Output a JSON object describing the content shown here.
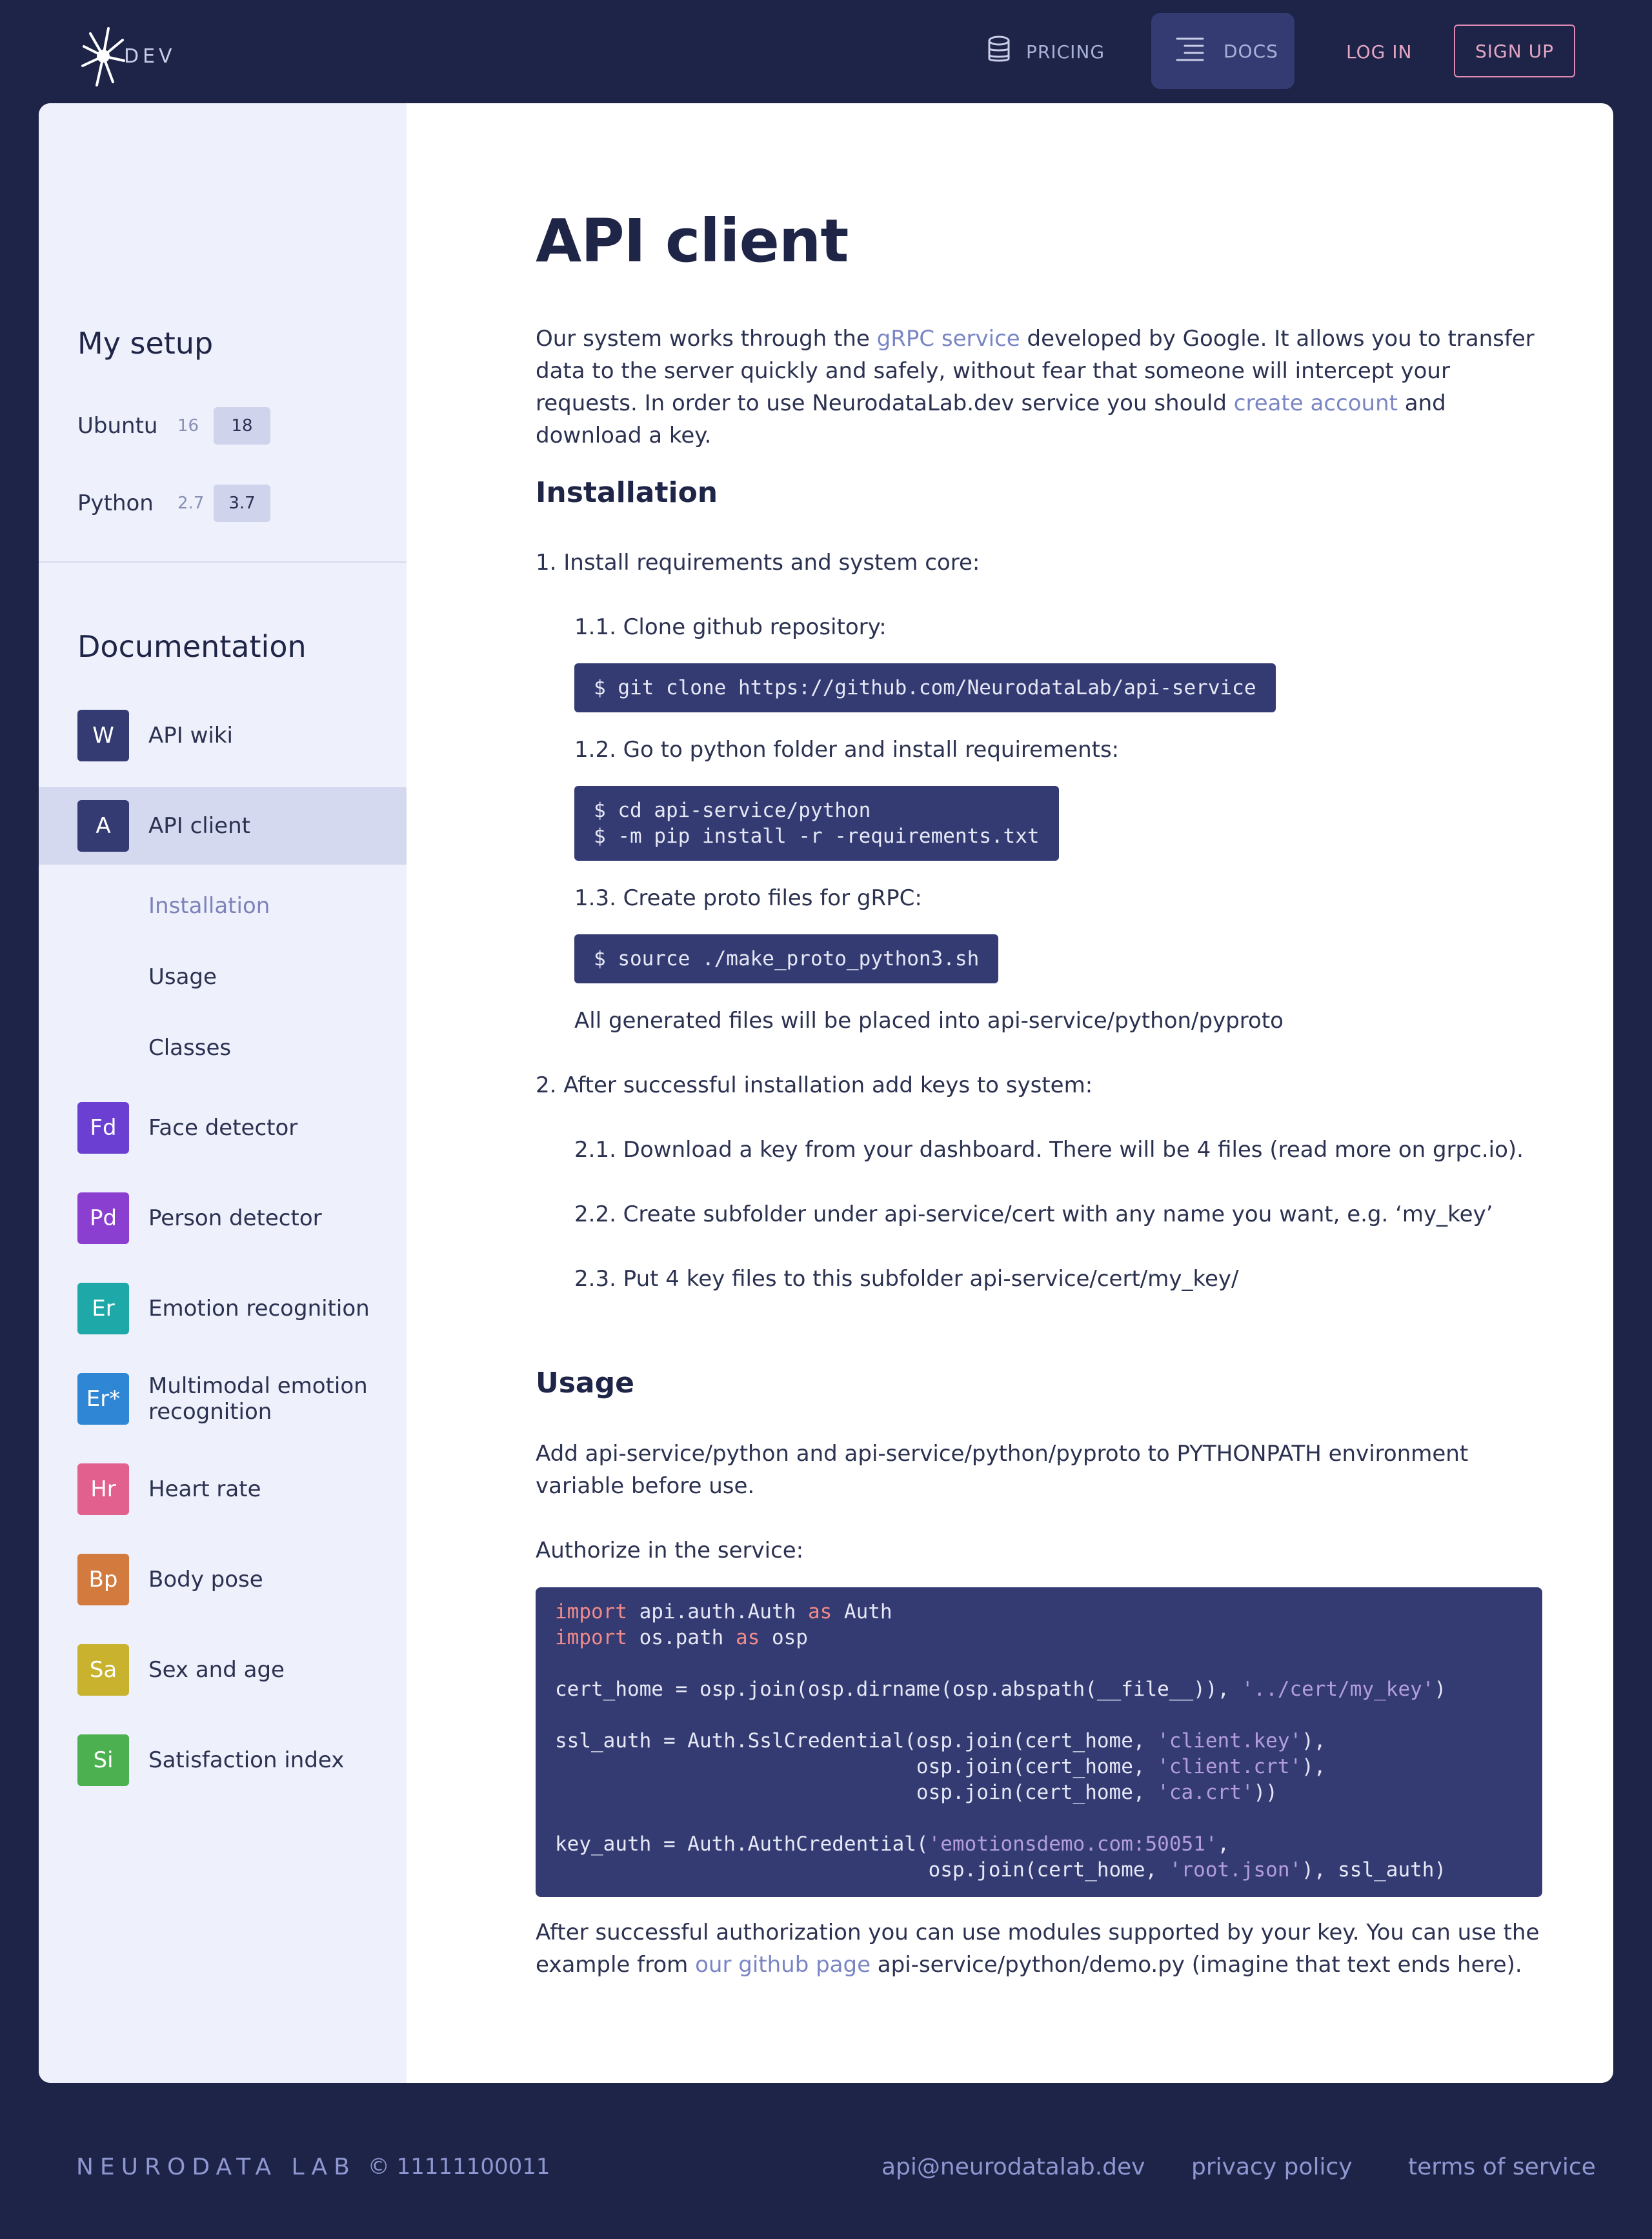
{
  "header": {
    "logo_text": "DEV",
    "nav": {
      "pricing": "PRICING",
      "docs": "DOCS",
      "login": "LOG IN",
      "signup": "SIGN UP"
    }
  },
  "sidebar": {
    "setup_title": "My setup",
    "setup": [
      {
        "label": "Ubuntu",
        "alt": "16",
        "selected": "18"
      },
      {
        "label": "Python",
        "alt": "2.7",
        "selected": "3.7"
      }
    ],
    "docs_title": "Documentation",
    "items": [
      {
        "badge": "W",
        "label": "API wiki",
        "color": "#333b72"
      },
      {
        "badge": "A",
        "label": "API client",
        "color": "#333b72",
        "active": true
      },
      {
        "badge": "Fd",
        "label": "Face detector",
        "color": "#6a3fd1"
      },
      {
        "badge": "Pd",
        "label": "Person detector",
        "color": "#8b3fd1"
      },
      {
        "badge": "Er",
        "label": "Emotion recognition",
        "color": "#1ea8a8"
      },
      {
        "badge": "Er*",
        "label": "Multimodal emotion recognition",
        "color": "#2f86d4"
      },
      {
        "badge": "Hr",
        "label": "Heart rate",
        "color": "#e2608d"
      },
      {
        "badge": "Bp",
        "label": "Body pose",
        "color": "#d37a3e"
      },
      {
        "badge": "Sa",
        "label": "Sex and age",
        "color": "#c9b22d"
      },
      {
        "badge": "Si",
        "label": "Satisfaction index",
        "color": "#4caf50"
      }
    ],
    "subitems": [
      "Installation",
      "Usage",
      "Classes"
    ]
  },
  "content": {
    "title": "API client",
    "intro": {
      "t1": "Our system works through the ",
      "link1": "gRPC service",
      "t2": " developed by Google. It allows you to transfer data to the server quickly and safely, without fear that someone will intercept your requests. In order to use NeurodataLab.dev service you should ",
      "link2": "create account",
      "t3": " and download a key."
    },
    "installation_title": "Installation",
    "step1": "1. Install requirements and system core:",
    "step1_1": "1.1. Clone github repository:",
    "code1": "$ git clone https://github.com/NeurodataLab/api-service",
    "step1_2": "1.2. Go to python folder and install requirements:",
    "code2": "$ cd api-service/python\n$ -m pip install -r -requirements.txt",
    "step1_3": "1.3. Create proto files for gRPC:",
    "code3": "$ source ./make_proto_python3.sh",
    "generated_note": "All generated files will be placed into api-service/python/pyproto",
    "step2": "2. After successful installation add keys to system:",
    "step2_1": "2.1. Download a key from your dashboard. There will be 4 files (read more on grpc.io).",
    "step2_2": "2.2. Create subfolder under api-service/cert with any name you want, e.g. ‘my_key’",
    "step2_3": "2.3. Put 4 key files to this subfolder api-service/cert/my_key/",
    "usage_title": "Usage",
    "usage_p1": "Add api-service/python and api-service/python/pyproto to PYTHONPATH environment variable before use.",
    "usage_p2": "Authorize in the service:",
    "final": {
      "t1": "After successful authorization you can use modules supported by your key. You can use the example from ",
      "link": "our github page",
      "t2": " api-service/python/demo.py (imagine that text ends here)."
    }
  },
  "footer": {
    "brand": "NEURODATA LAB",
    "copyright": "© 11111100011",
    "email": "api@neurodatalab.dev",
    "privacy": "privacy policy",
    "terms": "terms of service"
  }
}
